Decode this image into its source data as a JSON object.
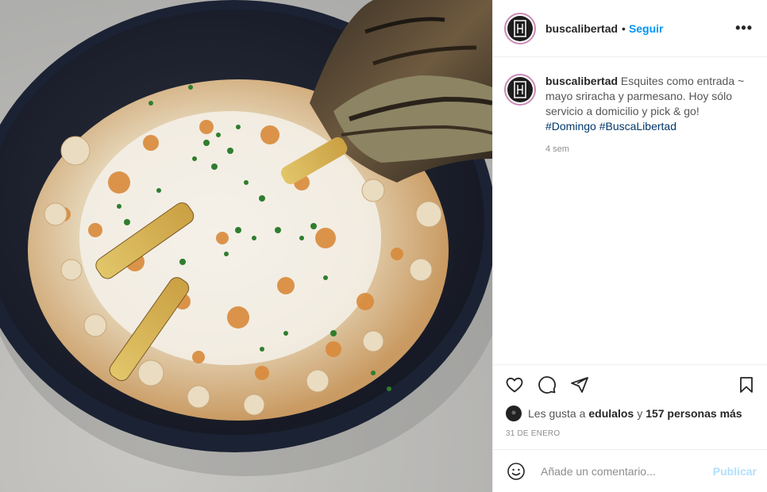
{
  "post": {
    "image_alt": "Bowl of esquites with grilled corn, parmesan and chives",
    "author": {
      "username": "buscalibertad",
      "separator": "•",
      "follow_label": "Seguir",
      "more_label": "•••"
    },
    "caption": {
      "username": "buscalibertad",
      "text": "Esquites como entrada ~ mayo sriracha y parmesano. Hoy sólo servicio a domicilio y pick & go!",
      "hashtags": [
        "#Domingo",
        "#BuscaLibertad"
      ],
      "age": "4 sem"
    },
    "actions": {
      "icons": [
        "heart-icon",
        "comment-icon",
        "share-icon",
        "bookmark-icon"
      ]
    },
    "likes": {
      "prefix": "Les gusta a",
      "user": "edulalos",
      "connector": "y",
      "others": "157 personas más"
    },
    "date": "31 DE ENERO",
    "add_comment": {
      "placeholder": "Añade un comentario...",
      "publish_label": "Publicar"
    },
    "colors": {
      "accent": "#0095f6",
      "publish_disabled": "#b2dffc",
      "hashtag": "#00376b",
      "avatar_ring": "#c98bb6"
    }
  }
}
